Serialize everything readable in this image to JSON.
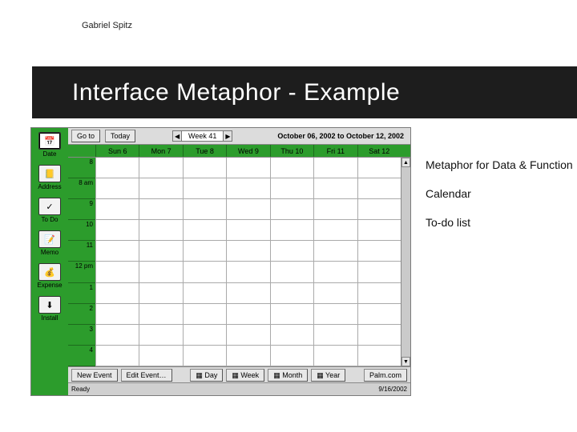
{
  "author": "Gabriel Spitz",
  "title": "Interface Metaphor - Example",
  "rail": [
    {
      "label": "Date",
      "glyph": "📅"
    },
    {
      "label": "Address",
      "glyph": "📒"
    },
    {
      "label": "To Do",
      "glyph": "✓"
    },
    {
      "label": "Memo",
      "glyph": "📝"
    },
    {
      "label": "Expense",
      "glyph": "💰"
    },
    {
      "label": "Install",
      "glyph": "⬇"
    }
  ],
  "toolbar": {
    "goto": "Go to",
    "today": "Today",
    "prev": "◀",
    "next": "▶",
    "week_label": "Week 41",
    "range": "October 06, 2002 to October 12, 2002"
  },
  "days": [
    "Sun 6",
    "Mon 7",
    "Tue 8",
    "Wed 9",
    "Thu 10",
    "Fri 11",
    "Sat 12"
  ],
  "times": [
    "8",
    "8 am",
    "9",
    "10",
    "11",
    "12 pm",
    "1",
    "2",
    "3",
    "4"
  ],
  "bottom": {
    "new_event": "New Event",
    "edit_event": "Edit Event…",
    "day": "▦ Day",
    "week": "▦ Week",
    "month": "▦ Month",
    "year": "▦ Year",
    "brand": "Palm.com"
  },
  "status": {
    "ready": "Ready",
    "date": "9/16/2002"
  },
  "annotations": {
    "line1": "Metaphor for Data & Function",
    "line2": "Calendar",
    "line3": "To-do list"
  }
}
